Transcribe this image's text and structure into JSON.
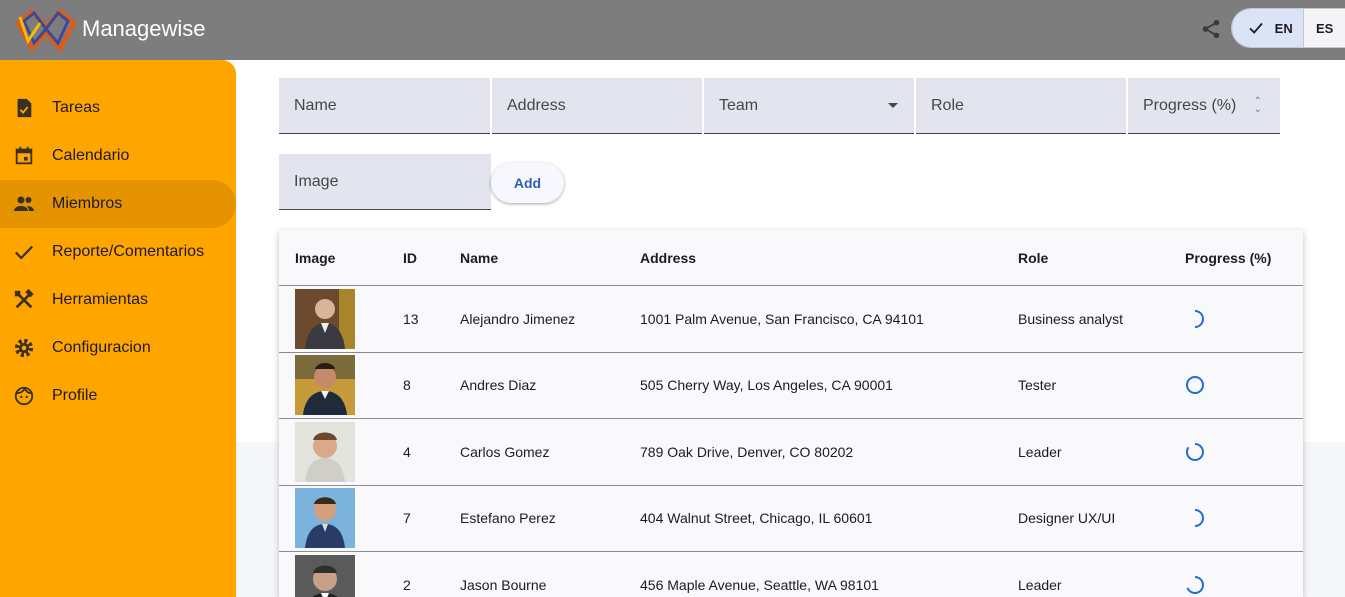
{
  "app": {
    "title": "Managewise"
  },
  "header": {
    "languages": [
      {
        "code": "EN",
        "selected": true
      },
      {
        "code": "ES",
        "selected": false
      }
    ],
    "icons": {
      "share": "share-icon",
      "check": "check-icon"
    }
  },
  "sidebar": {
    "items": [
      {
        "label": "Tareas",
        "icon": "task-icon",
        "active": false
      },
      {
        "label": "Calendario",
        "icon": "calendar-icon",
        "active": false
      },
      {
        "label": "Miembros",
        "icon": "people-icon",
        "active": true
      },
      {
        "label": "Reporte/Comentarios",
        "icon": "check-icon",
        "active": false
      },
      {
        "label": "Herramientas",
        "icon": "tools-icon",
        "active": false
      },
      {
        "label": "Configuracion",
        "icon": "gear-icon",
        "active": false
      },
      {
        "label": "Profile",
        "icon": "face-icon",
        "active": false
      }
    ]
  },
  "form": {
    "name_placeholder": "Name",
    "address_placeholder": "Address",
    "team_placeholder": "Team",
    "role_placeholder": "Role",
    "progress_placeholder": "Progress (%)",
    "image_placeholder": "Image",
    "add_label": "Add"
  },
  "table": {
    "headers": [
      "Image",
      "ID",
      "Name",
      "Address",
      "Role",
      "Progress (%)"
    ],
    "rows": [
      {
        "id": "13",
        "name": "Alejandro Jimenez",
        "address": "1001 Palm Avenue, San Francisco, CA 94101",
        "role": "Business analyst",
        "photo": "portrait-photo"
      },
      {
        "id": "8",
        "name": "Andres Diaz",
        "address": "505 Cherry Way, Los Angeles, CA 90001",
        "role": "Tester",
        "photo": "portrait-photo"
      },
      {
        "id": "4",
        "name": "Carlos Gomez",
        "address": "789 Oak Drive, Denver, CO 80202",
        "role": "Leader",
        "photo": "portrait-photo"
      },
      {
        "id": "7",
        "name": "Estefano Perez",
        "address": "404 Walnut Street, Chicago, IL 60601",
        "role": "Designer UX/UI",
        "photo": "portrait-photo"
      },
      {
        "id": "2",
        "name": "Jason Bourne",
        "address": "456 Maple Avenue, Seattle, WA 98101",
        "role": "Leader",
        "photo": "portrait-photo"
      }
    ]
  },
  "colors": {
    "header_bg": "#7d7d7d",
    "sidebar_bg": "#ffa500",
    "sidebar_active": "#e59400",
    "accent_blue": "#2e5ea8",
    "progress_spinner": "#1f6fd1"
  }
}
